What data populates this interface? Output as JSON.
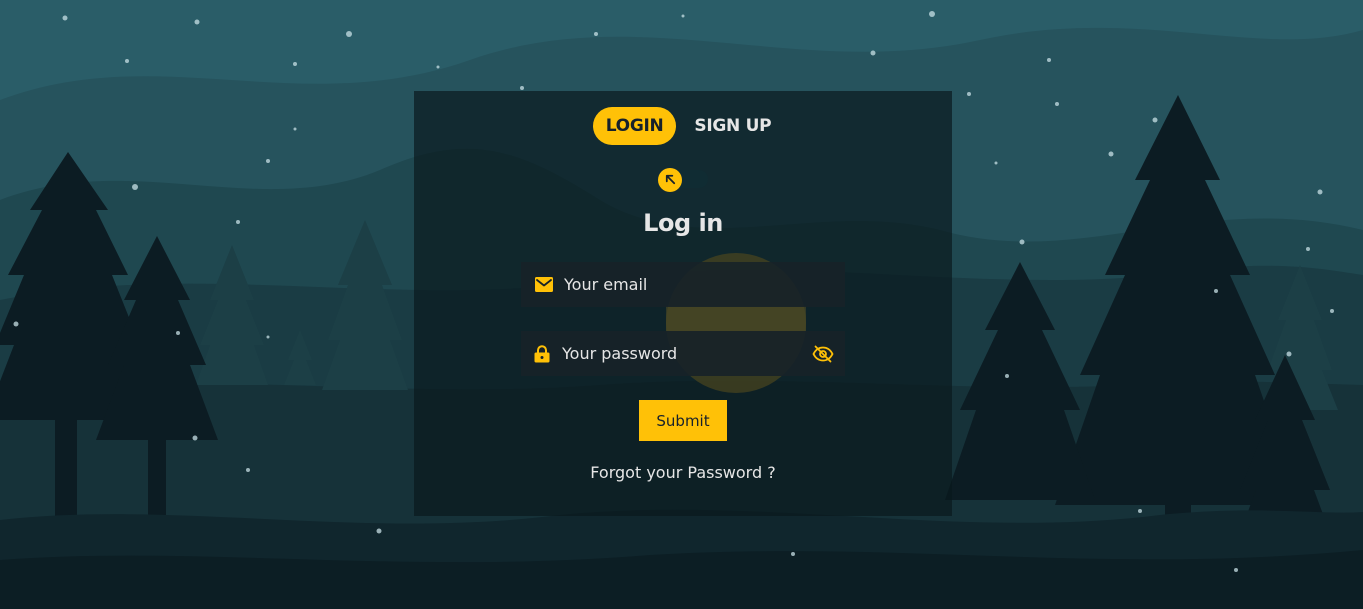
{
  "tabs": [
    {
      "label": "LOGIN",
      "active": true
    },
    {
      "label": "SIGN UP",
      "active": false
    }
  ],
  "toggle": {
    "icon": "arrow-up-left-icon",
    "state": "off"
  },
  "form": {
    "heading": "Log in",
    "email": {
      "placeholder": "Your email",
      "icon": "mail-icon"
    },
    "password": {
      "placeholder": "Your password",
      "icon": "lock-icon",
      "toggle_icon": "eye-off-icon"
    },
    "submit_label": "Submit",
    "forgot_link": "Forgot your Password ?"
  },
  "colors": {
    "accent": "#ffc107",
    "card": "#09181c",
    "text": "#e6e6e6",
    "sky": "#2a5d68",
    "trees": "#0b1a21"
  }
}
